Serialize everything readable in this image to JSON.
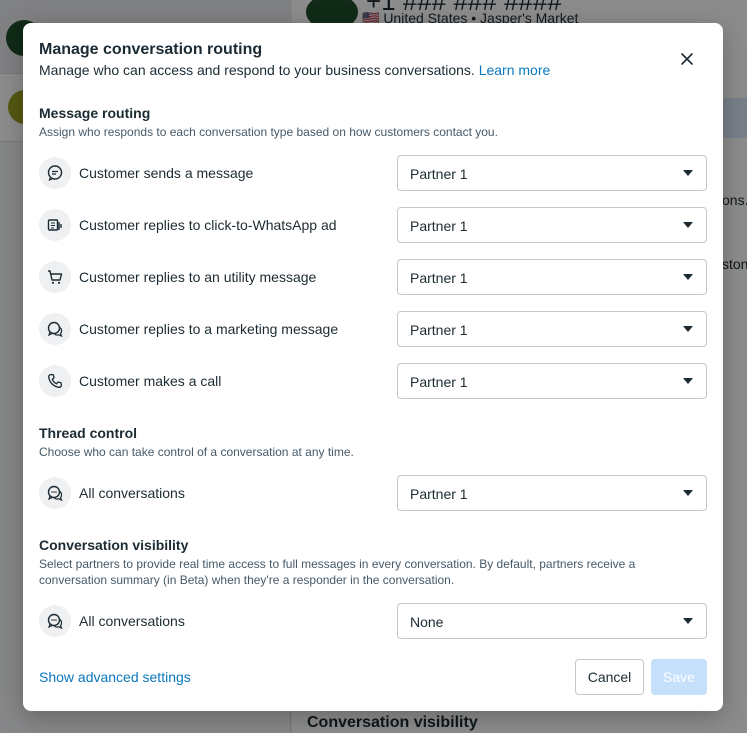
{
  "background": {
    "phone_heading": "+1 ### ### ####",
    "business_sub": "🇺🇸 United States • Jasper's Market",
    "right_text_1": "ons.",
    "right_text_2": "ston",
    "bottom_title": "Conversation visibility"
  },
  "modal": {
    "title": "Manage conversation routing",
    "description": "Manage who can access and respond to your business conversations.",
    "learn_more": "Learn more"
  },
  "message_routing": {
    "title": "Message routing",
    "description": "Assign who responds to each conversation type based on how customers contact you.",
    "rows": [
      {
        "icon": "message-icon",
        "label": "Customer sends a message",
        "value": "Partner 1"
      },
      {
        "icon": "ad-icon",
        "label": "Customer replies to click-to-WhatsApp ad",
        "value": "Partner 1"
      },
      {
        "icon": "cart-icon",
        "label": "Customer replies to an utility message",
        "value": "Partner 1"
      },
      {
        "icon": "chat-bubbles-icon",
        "label": "Customer replies to a marketing message",
        "value": "Partner 1"
      },
      {
        "icon": "phone-icon",
        "label": "Customer makes a call",
        "value": "Partner 1"
      }
    ]
  },
  "thread_control": {
    "title": "Thread control",
    "description": "Choose who can take control of a conversation at any time.",
    "row": {
      "icon": "conversations-icon",
      "label": "All conversations",
      "value": "Partner 1"
    }
  },
  "conversation_visibility": {
    "title": "Conversation visibility",
    "description": "Select partners to provide real time access to full messages in every conversation. By default, partners receive a conversation summary (in Beta) when they're a responder in the conversation.",
    "row": {
      "icon": "conversations-icon",
      "label": "All conversations",
      "value": "None"
    }
  },
  "footer": {
    "advanced_link": "Show advanced settings",
    "cancel_label": "Cancel",
    "save_label": "Save"
  },
  "colors": {
    "link": "#0a78be",
    "save_disabled_bg": "#c6e0fb",
    "overlay": "rgba(0,0,0,0.45)"
  }
}
